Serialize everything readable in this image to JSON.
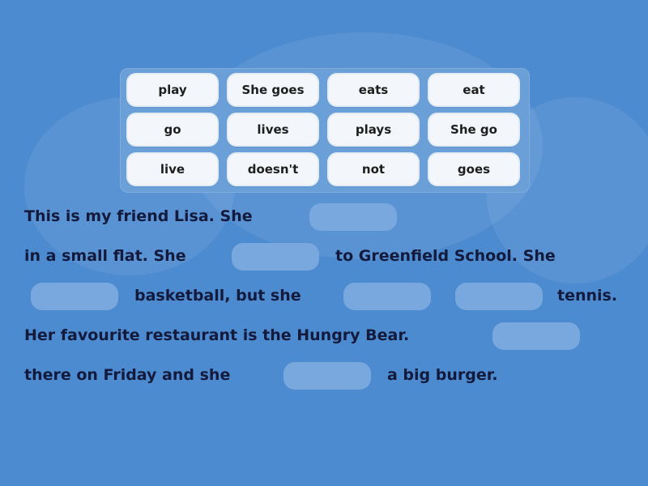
{
  "word_bank": [
    "play",
    "She goes",
    "eats",
    "eat",
    "go",
    "lives",
    "plays",
    "She go",
    "live",
    "doesn't",
    "not",
    "goes"
  ],
  "text": {
    "l1": "This is my friend Lisa. She",
    "l2a": "in a small flat. She",
    "l2b": "to Greenfield School. She",
    "l3a": "basketball, but she",
    "l3b": "tennis.",
    "l4": "Her favourite restaurant is the Hungry Bear.",
    "l5a": "there on Friday and she",
    "l5b": "a big burger."
  }
}
